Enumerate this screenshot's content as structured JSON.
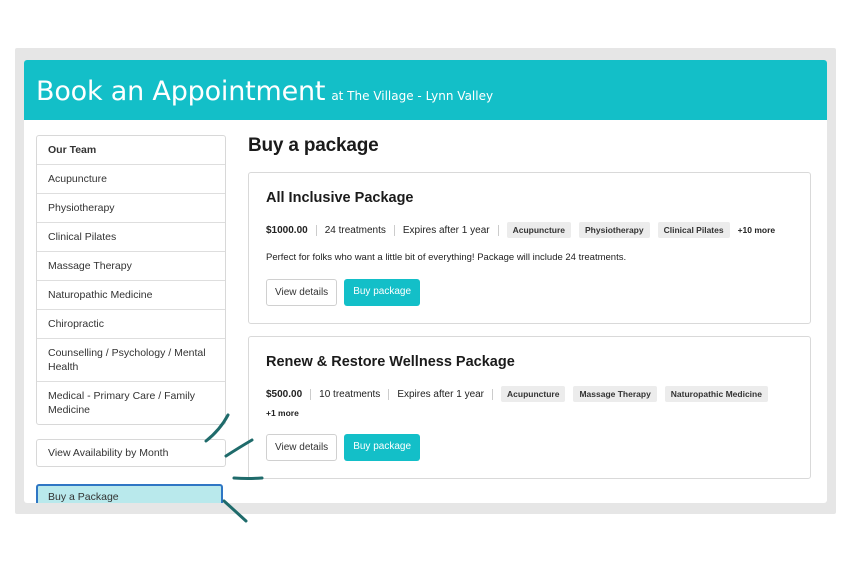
{
  "header": {
    "title": "Book an Appointment",
    "location": "at The Village - Lynn Valley"
  },
  "sidebar": {
    "items": [
      {
        "label": "Our Team"
      },
      {
        "label": "Acupuncture"
      },
      {
        "label": "Physiotherapy"
      },
      {
        "label": "Clinical Pilates"
      },
      {
        "label": "Massage Therapy"
      },
      {
        "label": "Naturopathic Medicine"
      },
      {
        "label": "Chiropractic"
      },
      {
        "label": "Counselling / Psychology / Mental Health"
      },
      {
        "label": "Medical - Primary Care / Family Medicine"
      }
    ],
    "view_availability": "View Availability by Month",
    "buy_package": "Buy a Package"
  },
  "main": {
    "heading": "Buy a package",
    "packages": [
      {
        "name": "All Inclusive Package",
        "price": "$1000.00",
        "treatments": "24 treatments",
        "expires": "Expires after 1 year",
        "tags": [
          "Acupuncture",
          "Physiotherapy",
          "Clinical Pilates"
        ],
        "more": "+10 more",
        "description": "Perfect for folks who want a little bit of everything! Package will include 24 treatments.",
        "view_label": "View details",
        "buy_label": "Buy package"
      },
      {
        "name": "Renew & Restore Wellness Package",
        "price": "$500.00",
        "treatments": "10 treatments",
        "expires": "Expires after 1 year",
        "tags": [
          "Acupuncture",
          "Massage Therapy",
          "Naturopathic Medicine"
        ],
        "more": "+1 more",
        "view_label": "View details",
        "buy_label": "Buy package"
      }
    ]
  },
  "colors": {
    "accent": "#13bfc8",
    "highlight": "#b9e9ec",
    "focus_border": "#2f76c4",
    "marker": "#1f6b6b"
  }
}
